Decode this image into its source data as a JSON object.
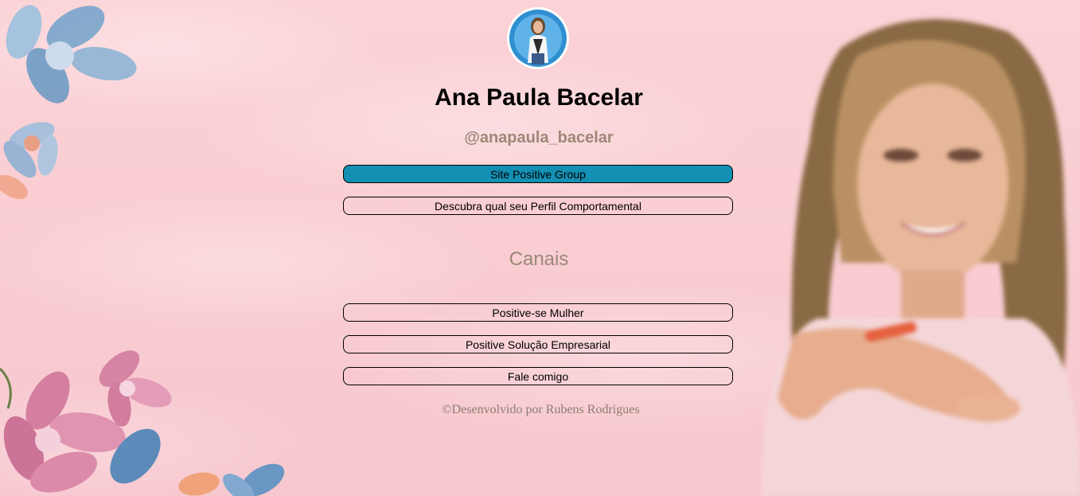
{
  "profile": {
    "name": "Ana Paula Bacelar",
    "handle": "@anapaula_bacelar"
  },
  "links": {
    "site": "Site Positive Group",
    "perfil": "Descubra qual seu Perfil Comportamental"
  },
  "channels": {
    "title": "Canais",
    "items": [
      "Positive-se Mulher",
      "Positive Solução Empresarial",
      "Fale comigo"
    ]
  },
  "footer": {
    "credit": "©Desenvolvido por Rubens Rodrigues"
  },
  "colors": {
    "accent": "#1390b3",
    "background": "#f9cdd2",
    "muted_text": "#9b8876"
  }
}
